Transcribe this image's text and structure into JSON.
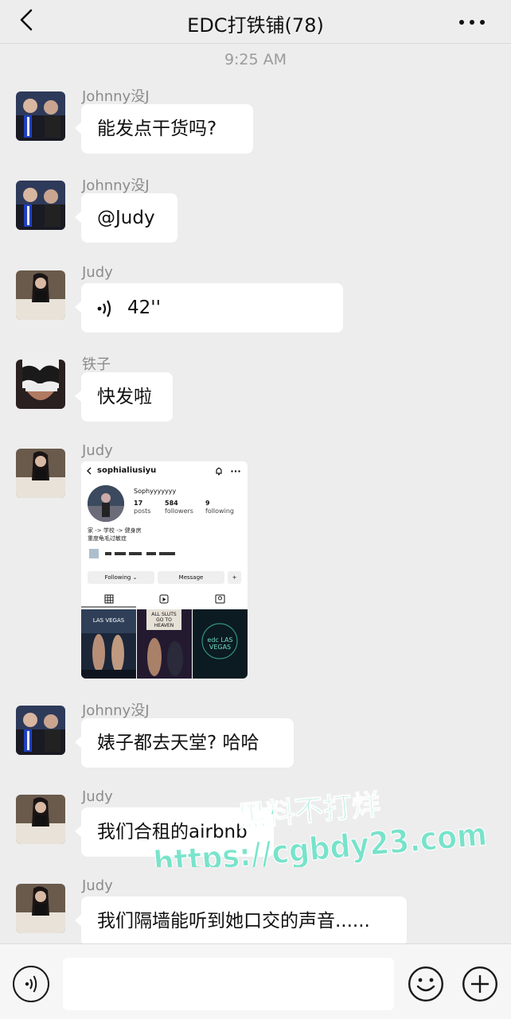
{
  "header": {
    "title": "EDC打铁铺(78)"
  },
  "timestamp": "9:25 AM",
  "messages": [
    {
      "sender": "Johnny没J",
      "text": "能发点干货吗?"
    },
    {
      "sender": "Johnny没J",
      "text": "@Judy"
    },
    {
      "sender": "Judy",
      "voice_duration": "42''"
    },
    {
      "sender": "铁子",
      "text": "快发啦"
    },
    {
      "sender": "Judy",
      "type": "image"
    },
    {
      "sender": "Johnny没J",
      "text": "婊子都去天堂? 哈哈"
    },
    {
      "sender": "Judy",
      "text": "我们合租的airbnb"
    },
    {
      "sender": "Judy",
      "text": "我们隔墙能听到她口交的声音......"
    }
  ],
  "shared_image": {
    "handle": "sophialiusiyu",
    "display_name": "Sophyyyyyyy",
    "posts_count": "17",
    "posts_label": "posts",
    "followers_count": "584",
    "followers_label": "followers",
    "following_count": "9",
    "following_label": "following",
    "bio_line1": "家 -> 学校 -> 健身房",
    "bio_line2": "重度龟毛过敏症",
    "following_button": "Following",
    "message_button": "Message",
    "grid_text_1": "LAS VEGAS",
    "grid_text_2": "ALL SLUTS GO TO HEAVEN",
    "grid_text_3": "edc LAS VEGAS"
  },
  "watermark": {
    "line1": "黑料不打烊",
    "line2": "https://cgbdy23.com"
  },
  "colors": {
    "background": "#ededed",
    "bubble": "#ffffff",
    "watermark": "#6fe3c8"
  }
}
